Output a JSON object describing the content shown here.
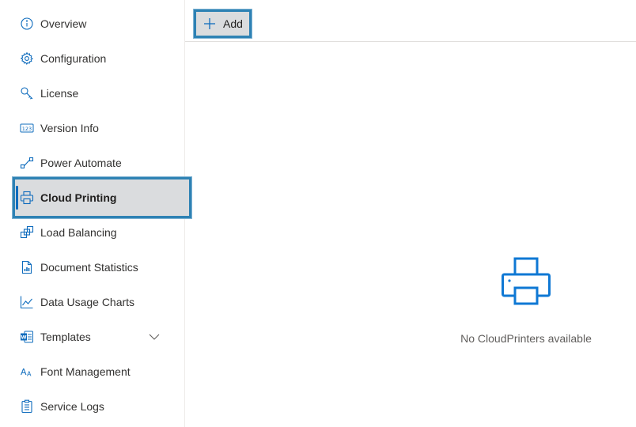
{
  "sidebar": {
    "items": [
      {
        "label": "Overview",
        "icon": "info-icon"
      },
      {
        "label": "Configuration",
        "icon": "gear-icon"
      },
      {
        "label": "License",
        "icon": "key-icon"
      },
      {
        "label": "Version Info",
        "icon": "number-123-icon"
      },
      {
        "label": "Power Automate",
        "icon": "flow-icon"
      },
      {
        "label": "Cloud Printing",
        "icon": "printer-icon",
        "active": true
      },
      {
        "label": "Load Balancing",
        "icon": "stacked-windows-icon"
      },
      {
        "label": "Document Statistics",
        "icon": "document-chart-icon"
      },
      {
        "label": "Data Usage Charts",
        "icon": "line-chart-icon"
      },
      {
        "label": "Templates",
        "icon": "word-document-icon"
      },
      {
        "label": "Font Management",
        "icon": "font-size-icon"
      },
      {
        "label": "Service Logs",
        "icon": "clipboard-icon"
      }
    ]
  },
  "toolbar": {
    "add_label": "Add"
  },
  "empty_state": {
    "message": "No CloudPrinters available"
  },
  "colors": {
    "accent": "#0f6cbd",
    "highlight_border": "#2e82b4",
    "selected_bg": "#dadcde",
    "empty_icon": "#0f78d4"
  }
}
